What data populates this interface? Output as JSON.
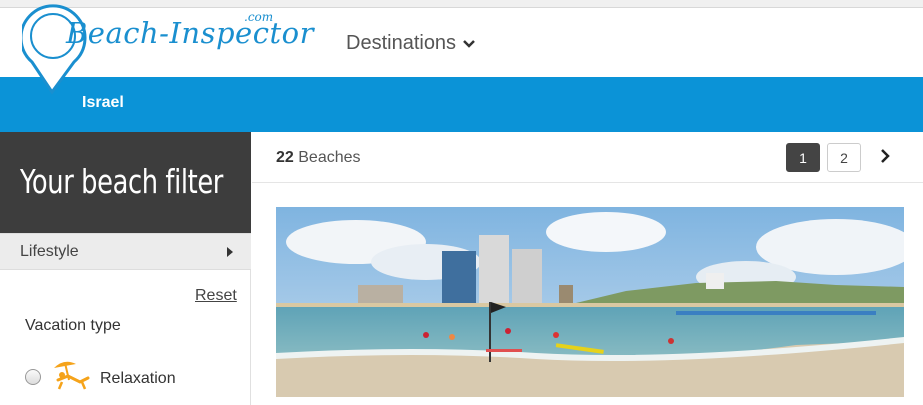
{
  "header": {
    "logo_text": "Beach-Inspector",
    "logo_suffix": ".com",
    "nav_destinations": "Destinations"
  },
  "breadcrumb": {
    "country": "Israel"
  },
  "sidebar": {
    "title": "Your beach filter",
    "lifestyle_label": "Lifestyle",
    "reset_label": "Reset",
    "vacation_type_label": "Vacation type",
    "options": [
      {
        "label": "Relaxation",
        "icon": "sunbed-umbrella-icon"
      }
    ]
  },
  "results": {
    "count": "22",
    "count_label": "Beaches",
    "pages": [
      "1",
      "2"
    ],
    "current_page": "1"
  },
  "colors": {
    "brand_blue": "#0b93d7",
    "dark_panel": "#3d3d3d",
    "accent_orange": "#f5a31a"
  }
}
